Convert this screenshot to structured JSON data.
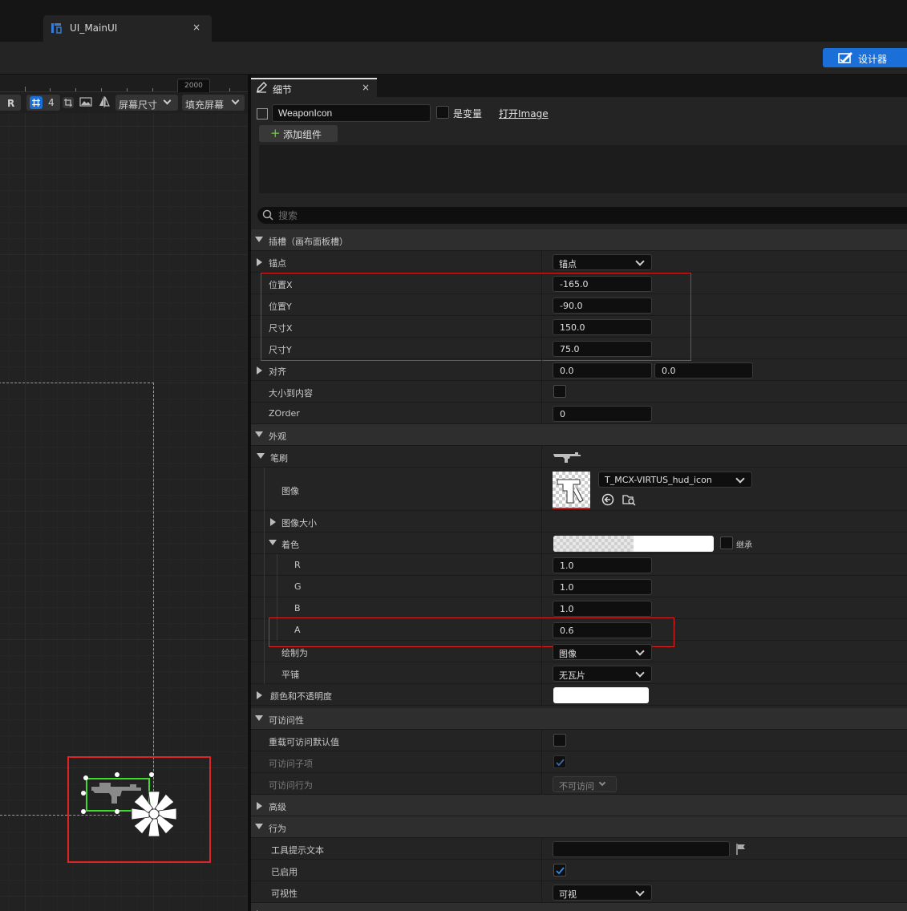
{
  "document_tab": {
    "title": "UI_MainUI",
    "close": "×"
  },
  "toolbar": {
    "designer_label": "设计器"
  },
  "viewport": {
    "ruler_label": "2000",
    "toolbar": {
      "r_label": "R",
      "grid_count": "4",
      "screen_size": "屏幕尺寸",
      "fill_screen": "填充屏幕"
    }
  },
  "details": {
    "tab_title": "细节",
    "tab_close": "×",
    "widget_name": "WeaponIcon",
    "is_variable_label": "是变量",
    "open_link": "打开Image",
    "add_component": "添加组件",
    "search_placeholder": "搜索",
    "slot": {
      "header": "插槽（画布面板槽）",
      "anchor_label": "锚点",
      "anchor_value": "锚点",
      "pos_x_label": "位置X",
      "pos_x": "-165.0",
      "pos_y_label": "位置Y",
      "pos_y": "-90.0",
      "size_x_label": "尺寸X",
      "size_x": "150.0",
      "size_y_label": "尺寸Y",
      "size_y": "75.0",
      "align_label": "对齐",
      "align_x": "0.0",
      "align_y": "0.0",
      "size_to_content_label": "大小到内容",
      "zorder_label": "ZOrder",
      "zorder": "0"
    },
    "appearance": {
      "header": "外观",
      "brush_label": "笔刷",
      "image_label": "图像",
      "image_asset": "T_MCX-VIRTUS_hud_icon",
      "image_size_label": "图像大小",
      "tint_label": "着色",
      "inherit_label": "继承",
      "r_label": "R",
      "r": "1.0",
      "g_label": "G",
      "g": "1.0",
      "b_label": "B",
      "b": "1.0",
      "a_label": "A",
      "a": "0.6",
      "draw_as_label": "绘制为",
      "draw_as": "图像",
      "tiling_label": "平铺",
      "tiling": "无瓦片",
      "color_opacity_label": "颜色和不透明度"
    },
    "accessibility": {
      "header": "可访问性",
      "override_label": "重载可访问默认值",
      "children_label": "可访问子项",
      "behavior_label": "可访问行为",
      "behavior_value": "不可访问"
    },
    "advanced": {
      "header": "高级"
    },
    "behavior": {
      "header": "行为",
      "tooltip_label": "工具提示文本",
      "enabled_label": "已启用",
      "visibility_label": "可视性",
      "visibility_value": "可视"
    }
  },
  "colors": {
    "accent": "#1a6fd8",
    "highlight_red": "#e02424",
    "selection_green": "#3ddc2a"
  }
}
